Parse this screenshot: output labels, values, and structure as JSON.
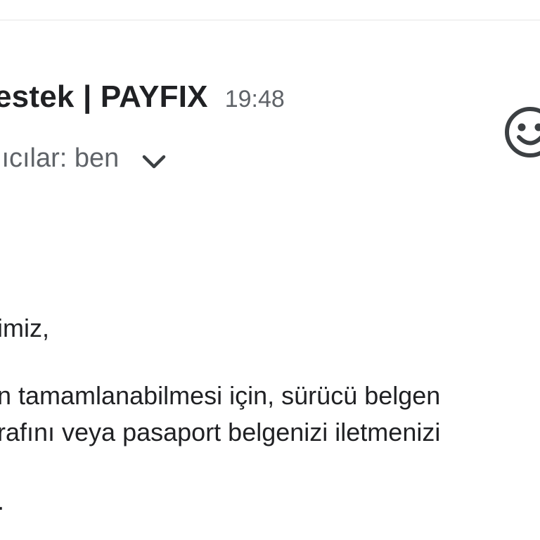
{
  "header": {
    "sender": "estek | PAYFIX",
    "time": "19:48"
  },
  "recipients": {
    "label": "lıcılar: ben"
  },
  "icons": {
    "expand": "chevron-down-icon",
    "reaction": "smiley-face-icon"
  },
  "message": {
    "greeting": "imiz,",
    "line1": "n tamamlanabilmesi için, sürücü belgen",
    "line2": "rafını veya pasaport belgenizi iletmenizi",
    "line3": "."
  },
  "colors": {
    "text_primary": "#202124",
    "text_secondary": "#5f6368",
    "icon": "#3c4043"
  }
}
